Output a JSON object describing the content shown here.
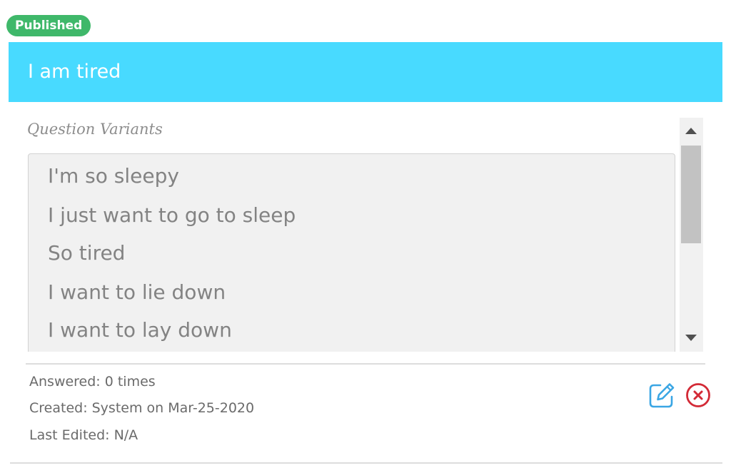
{
  "badge": {
    "status": "Published"
  },
  "title": "I am tired",
  "variants": {
    "heading": "Question Variants",
    "items": [
      "I'm so sleepy",
      "I just want to go to sleep",
      "So tired",
      "I want to lie down",
      "I want to lay down"
    ]
  },
  "meta": {
    "answered_label": "Answered:",
    "answered_value": "0 times",
    "created_label": "Created:",
    "created_value": "System on Mar-25-2020",
    "edited_label": "Last Edited:",
    "edited_value": "N/A"
  },
  "icons": {
    "edit": "edit-icon",
    "delete": "delete-icon"
  },
  "colors": {
    "published": "#3fb86a",
    "title_bar": "#48daff",
    "edit": "#3aa6e4",
    "delete": "#d32a36"
  }
}
